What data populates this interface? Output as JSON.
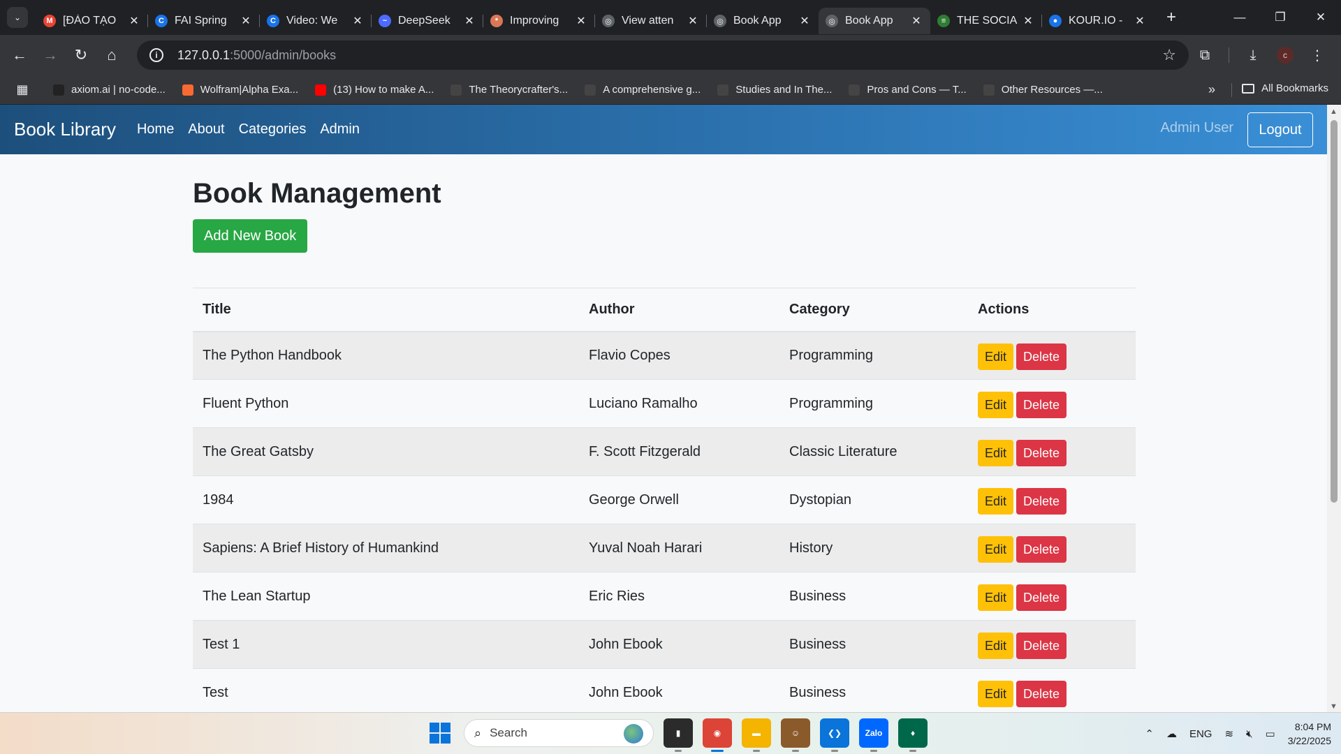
{
  "browser": {
    "tabs": [
      {
        "label": "[ĐÀO TẠO",
        "favicon_color": "#ea4335",
        "favicon_glyph": "M",
        "active": false
      },
      {
        "label": "FAI Spring",
        "favicon_color": "#1a73e8",
        "favicon_glyph": "C",
        "active": false
      },
      {
        "label": "Video: We",
        "favicon_color": "#1a73e8",
        "favicon_glyph": "C",
        "active": false
      },
      {
        "label": "DeepSeek",
        "favicon_color": "#4d6bfe",
        "favicon_glyph": "~",
        "active": false
      },
      {
        "label": "Improving",
        "favicon_color": "#d97757",
        "favicon_glyph": "*",
        "active": false
      },
      {
        "label": "View atten",
        "favicon_color": "#5f6368",
        "favicon_glyph": "◎",
        "active": false
      },
      {
        "label": "Book App",
        "favicon_color": "#5f6368",
        "favicon_glyph": "◎",
        "active": false
      },
      {
        "label": "Book App",
        "favicon_color": "#5f6368",
        "favicon_glyph": "◎",
        "active": true
      },
      {
        "label": "THE SOCIA",
        "favicon_color": "#2e7d32",
        "favicon_glyph": "≡",
        "active": false
      },
      {
        "label": "KOUR.IO -",
        "favicon_color": "#1a73e8",
        "favicon_glyph": "●",
        "active": false
      }
    ],
    "tab_close_glyph": "✕",
    "new_tab_glyph": "+",
    "url_host": "127.0.0.1",
    "url_rest": ":5000/admin/books",
    "profile_initial": "c",
    "bookmarks": [
      {
        "label": "axiom.ai | no-code...",
        "favicon_color": "#222222"
      },
      {
        "label": "Wolfram|Alpha Exa...",
        "favicon_color": "#f96932"
      },
      {
        "label": "(13) How to make A...",
        "favicon_color": "#ff0000"
      },
      {
        "label": "The Theorycrafter's...",
        "favicon_color": "#444444"
      },
      {
        "label": "A comprehensive g...",
        "favicon_color": "#444444"
      },
      {
        "label": "Studies and In The...",
        "favicon_color": "#444444"
      },
      {
        "label": "Pros and Cons — T...",
        "favicon_color": "#444444"
      },
      {
        "label": "Other Resources —...",
        "favicon_color": "#444444"
      }
    ],
    "all_bookmarks_label": "All Bookmarks"
  },
  "navbar": {
    "brand": "Book Library",
    "links": [
      "Home",
      "About",
      "Categories",
      "Admin"
    ],
    "user": "Admin User",
    "logout": "Logout",
    "gradient_start": "#1d4f7c",
    "gradient_end": "#3a8fd6"
  },
  "page": {
    "title": "Book Management",
    "add_button": "Add New Book",
    "table": {
      "headers": [
        "Title",
        "Author",
        "Category",
        "Actions"
      ],
      "rows": [
        {
          "title": "The Python Handbook",
          "author": "Flavio Copes",
          "category": "Programming"
        },
        {
          "title": "Fluent Python",
          "author": "Luciano Ramalho",
          "category": "Programming"
        },
        {
          "title": "The Great Gatsby",
          "author": "F. Scott Fitzgerald",
          "category": "Classic Literature"
        },
        {
          "title": "1984",
          "author": "George Orwell",
          "category": "Dystopian"
        },
        {
          "title": "Sapiens: A Brief History of Humankind",
          "author": "Yuval Noah Harari",
          "category": "History"
        },
        {
          "title": "The Lean Startup",
          "author": "Eric Ries",
          "category": "Business"
        },
        {
          "title": "Test 1",
          "author": "John Ebook",
          "category": "Business"
        },
        {
          "title": "Test",
          "author": "John Ebook",
          "category": "Business"
        }
      ],
      "edit_label": "Edit",
      "delete_label": "Delete"
    },
    "colors": {
      "add": "#28a745",
      "edit": "#ffc107",
      "delete": "#dc3545"
    }
  },
  "taskbar": {
    "search_placeholder": "Search",
    "apps": [
      {
        "name": "file-explorer-dark",
        "color": "#2b2b2b",
        "glyph": "▮"
      },
      {
        "name": "chrome",
        "color": "#db4437",
        "glyph": "◉",
        "active": true
      },
      {
        "name": "file-explorer",
        "color": "#f4b400",
        "glyph": "▬"
      },
      {
        "name": "portrait-app",
        "color": "#8b5a2b",
        "glyph": "☺"
      },
      {
        "name": "vscode",
        "color": "#0a74da",
        "glyph": "❮❯"
      },
      {
        "name": "zalo",
        "color": "#0068ff",
        "glyph": "Zalo"
      },
      {
        "name": "mongodb",
        "color": "#00684a",
        "glyph": "♦"
      }
    ],
    "language": "ENG",
    "time": "8:04 PM",
    "date": "3/22/2025"
  }
}
